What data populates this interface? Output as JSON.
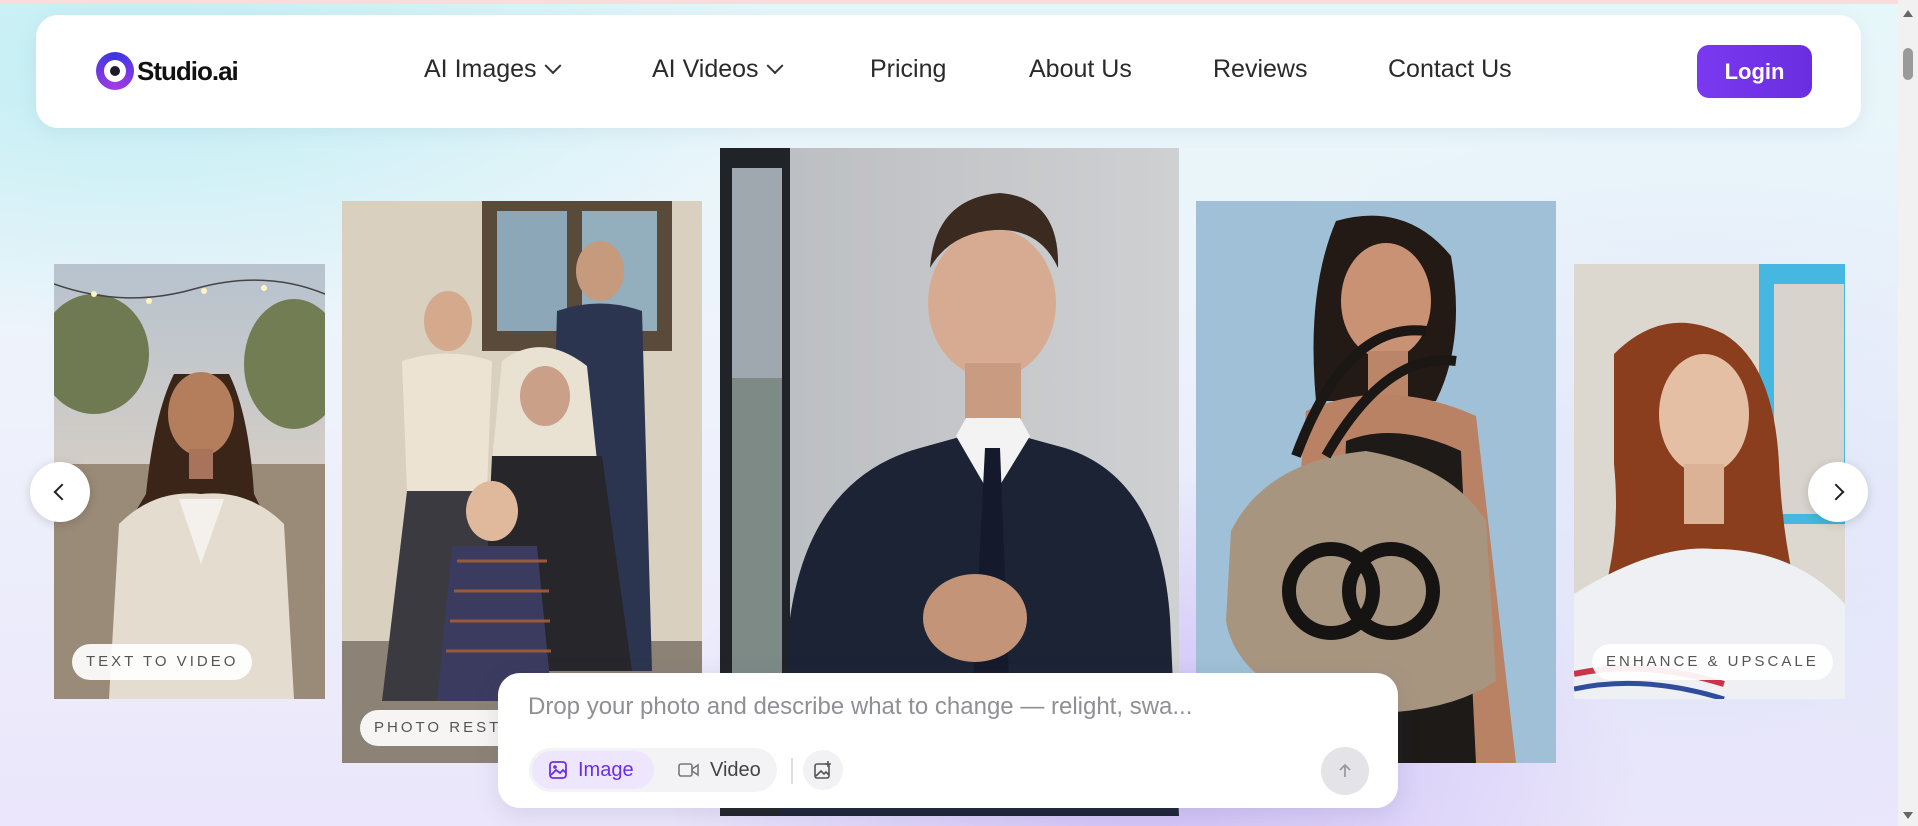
{
  "brand": {
    "name": "Studio.ai"
  },
  "nav": {
    "items": [
      {
        "label": "AI Images",
        "has_dropdown": true
      },
      {
        "label": "AI Videos",
        "has_dropdown": true
      },
      {
        "label": "Pricing",
        "has_dropdown": false
      },
      {
        "label": "About Us",
        "has_dropdown": false
      },
      {
        "label": "Reviews",
        "has_dropdown": false
      },
      {
        "label": "Contact Us",
        "has_dropdown": false
      }
    ],
    "login_label": "Login"
  },
  "carousel": {
    "cards": [
      {
        "label": "TEXT TO VIDEO",
        "subject": "woman-in-beige-blazer-on-terrace"
      },
      {
        "label": "PHOTO RESTO",
        "subject": "vintage-family-portrait"
      },
      {
        "label": "",
        "subject": "man-in-navy-suit"
      },
      {
        "label": "",
        "subject": "woman-with-designer-handbag"
      },
      {
        "label": "ENHANCE & UPSCALE",
        "subject": "red-haired-woman-portrait"
      }
    ],
    "prev_icon": "chevron-left-icon",
    "next_icon": "chevron-right-icon"
  },
  "prompt": {
    "placeholder": "Drop your photo and describe what to change — relight, swa...",
    "modes": [
      {
        "label": "Image",
        "icon": "image-icon",
        "active": true
      },
      {
        "label": "Video",
        "icon": "video-camera-icon",
        "active": false
      }
    ],
    "upload_icon": "add-image-icon",
    "send_icon": "arrow-up-icon"
  },
  "colors": {
    "accent": "#6c2fe0",
    "login_bg": "#7a39f0",
    "page_tint": "#e6f7fa"
  }
}
